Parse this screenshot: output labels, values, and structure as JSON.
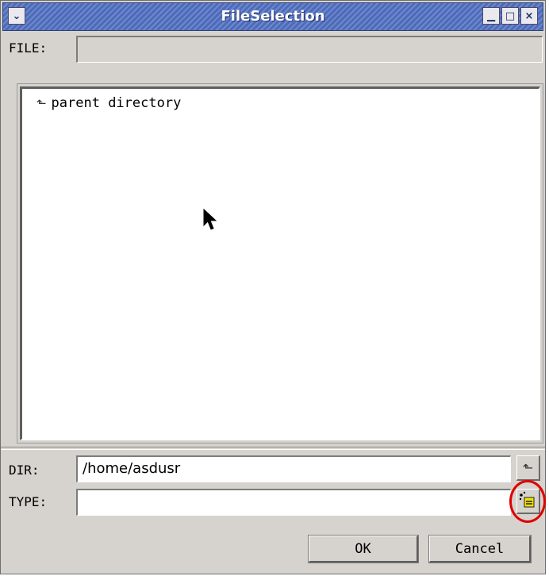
{
  "window": {
    "title": "FileSelection"
  },
  "file": {
    "label": "FILE:",
    "value": ""
  },
  "list": {
    "items": [
      {
        "icon": "up-arrow-icon",
        "label": "parent directory"
      }
    ]
  },
  "dir": {
    "label": "DIR:",
    "value": "/home/asdusr"
  },
  "type": {
    "label": "TYPE:",
    "value": ""
  },
  "buttons": {
    "ok": "OK",
    "cancel": "Cancel"
  },
  "colors": {
    "titlebar": "#5a76c2",
    "window_bg": "#d6d3ce",
    "highlight": "#e00000"
  }
}
